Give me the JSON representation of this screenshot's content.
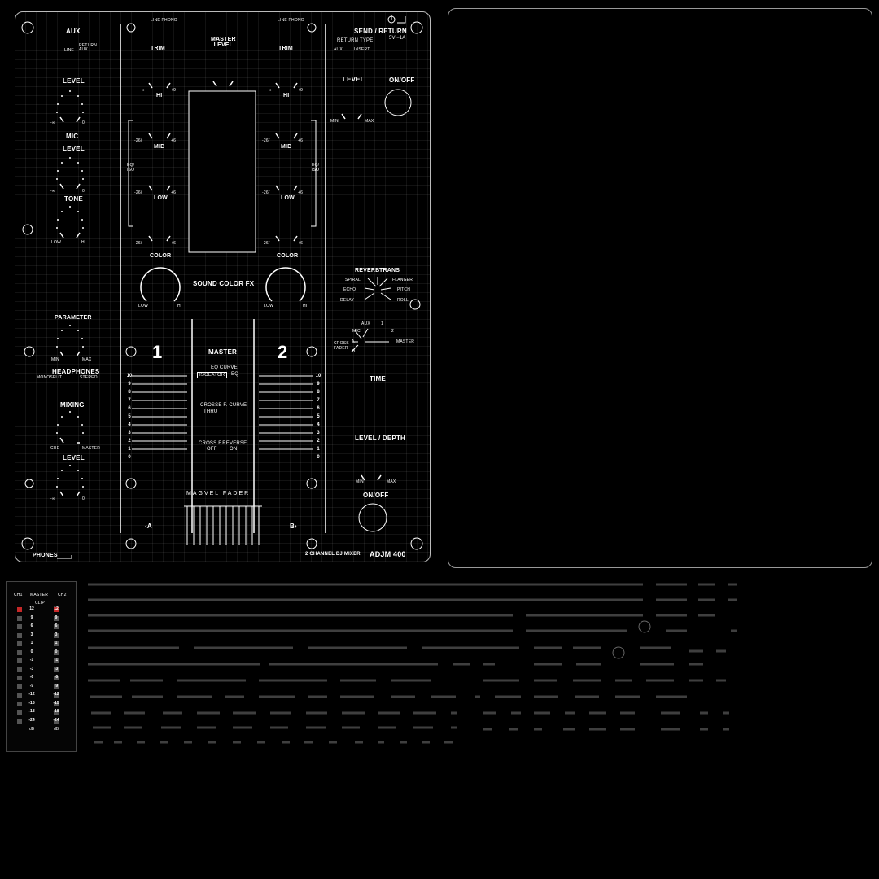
{
  "colors": {
    "line": "#ffffff",
    "grid": "#3a3a3a",
    "meter_red": "#c62828",
    "meter_dim": "#555555"
  },
  "top_left": {
    "aux": "AUX",
    "line": "LINE",
    "return": "RETURN",
    "aux_small": "AUX",
    "level": "LEVEL",
    "inf": "-∞",
    "zero": "0",
    "mic": "MIC",
    "mic_level": "LEVEL",
    "tone": "TONE",
    "low": "LOW",
    "hi": "HI",
    "parameter": "PARAMETER",
    "min": "MIN",
    "max": "MAX",
    "headphones": "HEADPHONES",
    "monosplit": "MONOSPLIT",
    "stereo": "STEREO",
    "mixing": "MIXING",
    "cue": "CUE",
    "master": "MASTER",
    "hp_level": "LEVEL",
    "phones": "PHONES"
  },
  "channels": [
    {
      "input": "LINE PHONO",
      "trim": "TRIM",
      "trim_min": "-∞",
      "trim_max": "+9",
      "hi": "HI",
      "mid": "MID",
      "low": "LOW",
      "eq_min": "-26/",
      "eq_mid": "-∞",
      "eq_max": "+6",
      "color": "COLOR",
      "color_low": "LOW",
      "color_hi": "HI",
      "number": "1",
      "cross": "A"
    },
    {
      "input": "LINE PHONO",
      "trim": "TRIM",
      "trim_min": "-∞",
      "trim_max": "+9",
      "hi": "HI",
      "mid": "MID",
      "low": "LOW",
      "eq_min": "-26/",
      "eq_mid": "-∞",
      "eq_max": "+6",
      "color": "COLOR",
      "color_low": "LOW",
      "color_hi": "HI",
      "number": "2",
      "cross": "B"
    }
  ],
  "center": {
    "master_level": "MASTER\nLEVEL",
    "sound_color_fx": "SOUND COLOR FX",
    "master": "MASTER",
    "eq_curve": "EQ CURVE",
    "isolator": "ISOLATOR",
    "eq": "EQ",
    "crossf_curve": "CROSSE F. CURVE",
    "thru": "THRU",
    "cross_reverse": "CROSS F.REVERSE",
    "off": "OFF",
    "on": "ON",
    "magvel": "MAGVEL FADER",
    "model_text": "2 CHANNEL DJ MIXER",
    "model": "ADJM 400",
    "eq_label": "EQ/",
    "iso_label": "ISO"
  },
  "fader_scale": [
    "10",
    "9",
    "8",
    "7",
    "6",
    "5",
    "4",
    "3",
    "2",
    "1",
    "0"
  ],
  "right": {
    "send_return": "SEND / RETURN",
    "return_type": "RETURN TYPE",
    "usb": "5V⎓1A",
    "aux": "AUX",
    "insert": "INSERT",
    "level": "LEVEL",
    "on_off": "ON/OFF",
    "min": "MIN",
    "max": "MAX",
    "fx_reverb": "REVERB",
    "fx_trans": "TRANS",
    "fx_spiral": "SPIRAL",
    "fx_flanger": "FLANGER",
    "fx_echo": "ECHO",
    "fx_pitch": "PITCH",
    "fx_delay": "DELAY",
    "fx_roll": "ROLL",
    "sel_aux": "AUX",
    "sel_1": "1",
    "sel_mic": "MIC",
    "sel_2": "2",
    "sel_a": "A",
    "sel_master": "MASTER",
    "sel_b": "B",
    "cross_fader": "CROSS\nFADER",
    "time": "TIME",
    "level_depth": "LEVEL / DEPTH",
    "on_off2": "ON/OFF"
  },
  "meter": {
    "ch1": "CH1",
    "master": "MASTER",
    "ch2": "CH2",
    "clip": "CLIP",
    "scale": [
      "12",
      "9",
      "6",
      "3",
      "1",
      "0",
      "-1",
      "-3",
      "-6",
      "-9",
      "-12",
      "-15",
      "-18",
      "-24"
    ],
    "db": "dB"
  }
}
